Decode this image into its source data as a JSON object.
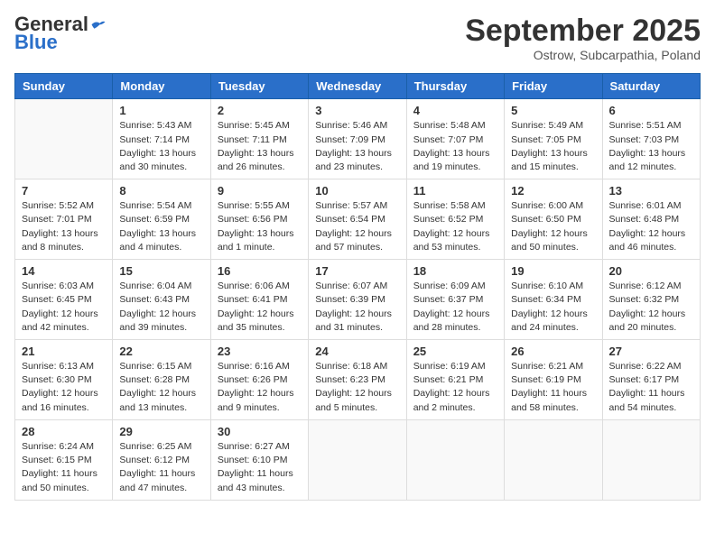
{
  "logo": {
    "general": "General",
    "blue": "Blue"
  },
  "title": "September 2025",
  "location": "Ostrow, Subcarpathia, Poland",
  "weekdays": [
    "Sunday",
    "Monday",
    "Tuesday",
    "Wednesday",
    "Thursday",
    "Friday",
    "Saturday"
  ],
  "weeks": [
    [
      {
        "day": null
      },
      {
        "day": "1",
        "sunrise": "5:43 AM",
        "sunset": "7:14 PM",
        "daylight": "13 hours and 30 minutes."
      },
      {
        "day": "2",
        "sunrise": "5:45 AM",
        "sunset": "7:11 PM",
        "daylight": "13 hours and 26 minutes."
      },
      {
        "day": "3",
        "sunrise": "5:46 AM",
        "sunset": "7:09 PM",
        "daylight": "13 hours and 23 minutes."
      },
      {
        "day": "4",
        "sunrise": "5:48 AM",
        "sunset": "7:07 PM",
        "daylight": "13 hours and 19 minutes."
      },
      {
        "day": "5",
        "sunrise": "5:49 AM",
        "sunset": "7:05 PM",
        "daylight": "13 hours and 15 minutes."
      },
      {
        "day": "6",
        "sunrise": "5:51 AM",
        "sunset": "7:03 PM",
        "daylight": "13 hours and 12 minutes."
      }
    ],
    [
      {
        "day": "7",
        "sunrise": "5:52 AM",
        "sunset": "7:01 PM",
        "daylight": "13 hours and 8 minutes."
      },
      {
        "day": "8",
        "sunrise": "5:54 AM",
        "sunset": "6:59 PM",
        "daylight": "13 hours and 4 minutes."
      },
      {
        "day": "9",
        "sunrise": "5:55 AM",
        "sunset": "6:56 PM",
        "daylight": "13 hours and 1 minute."
      },
      {
        "day": "10",
        "sunrise": "5:57 AM",
        "sunset": "6:54 PM",
        "daylight": "12 hours and 57 minutes."
      },
      {
        "day": "11",
        "sunrise": "5:58 AM",
        "sunset": "6:52 PM",
        "daylight": "12 hours and 53 minutes."
      },
      {
        "day": "12",
        "sunrise": "6:00 AM",
        "sunset": "6:50 PM",
        "daylight": "12 hours and 50 minutes."
      },
      {
        "day": "13",
        "sunrise": "6:01 AM",
        "sunset": "6:48 PM",
        "daylight": "12 hours and 46 minutes."
      }
    ],
    [
      {
        "day": "14",
        "sunrise": "6:03 AM",
        "sunset": "6:45 PM",
        "daylight": "12 hours and 42 minutes."
      },
      {
        "day": "15",
        "sunrise": "6:04 AM",
        "sunset": "6:43 PM",
        "daylight": "12 hours and 39 minutes."
      },
      {
        "day": "16",
        "sunrise": "6:06 AM",
        "sunset": "6:41 PM",
        "daylight": "12 hours and 35 minutes."
      },
      {
        "day": "17",
        "sunrise": "6:07 AM",
        "sunset": "6:39 PM",
        "daylight": "12 hours and 31 minutes."
      },
      {
        "day": "18",
        "sunrise": "6:09 AM",
        "sunset": "6:37 PM",
        "daylight": "12 hours and 28 minutes."
      },
      {
        "day": "19",
        "sunrise": "6:10 AM",
        "sunset": "6:34 PM",
        "daylight": "12 hours and 24 minutes."
      },
      {
        "day": "20",
        "sunrise": "6:12 AM",
        "sunset": "6:32 PM",
        "daylight": "12 hours and 20 minutes."
      }
    ],
    [
      {
        "day": "21",
        "sunrise": "6:13 AM",
        "sunset": "6:30 PM",
        "daylight": "12 hours and 16 minutes."
      },
      {
        "day": "22",
        "sunrise": "6:15 AM",
        "sunset": "6:28 PM",
        "daylight": "12 hours and 13 minutes."
      },
      {
        "day": "23",
        "sunrise": "6:16 AM",
        "sunset": "6:26 PM",
        "daylight": "12 hours and 9 minutes."
      },
      {
        "day": "24",
        "sunrise": "6:18 AM",
        "sunset": "6:23 PM",
        "daylight": "12 hours and 5 minutes."
      },
      {
        "day": "25",
        "sunrise": "6:19 AM",
        "sunset": "6:21 PM",
        "daylight": "12 hours and 2 minutes."
      },
      {
        "day": "26",
        "sunrise": "6:21 AM",
        "sunset": "6:19 PM",
        "daylight": "11 hours and 58 minutes."
      },
      {
        "day": "27",
        "sunrise": "6:22 AM",
        "sunset": "6:17 PM",
        "daylight": "11 hours and 54 minutes."
      }
    ],
    [
      {
        "day": "28",
        "sunrise": "6:24 AM",
        "sunset": "6:15 PM",
        "daylight": "11 hours and 50 minutes."
      },
      {
        "day": "29",
        "sunrise": "6:25 AM",
        "sunset": "6:12 PM",
        "daylight": "11 hours and 47 minutes."
      },
      {
        "day": "30",
        "sunrise": "6:27 AM",
        "sunset": "6:10 PM",
        "daylight": "11 hours and 43 minutes."
      },
      {
        "day": null
      },
      {
        "day": null
      },
      {
        "day": null
      },
      {
        "day": null
      }
    ]
  ]
}
